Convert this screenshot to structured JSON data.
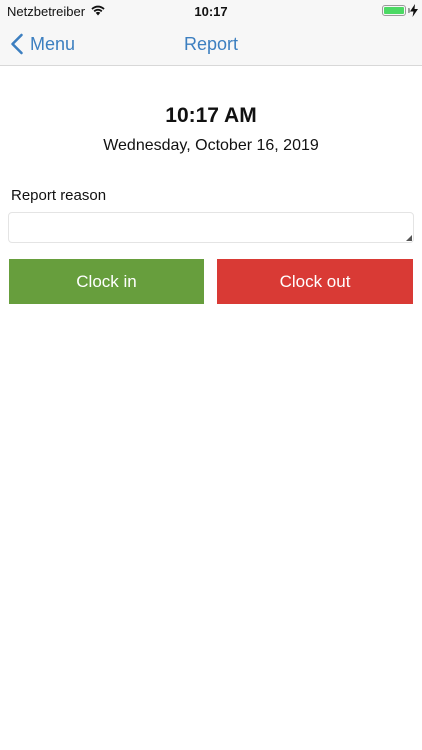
{
  "status_bar": {
    "carrier": "Netzbetreiber",
    "time": "10:17",
    "battery_level": 1.0,
    "icons": [
      "wifi-icon",
      "battery-icon",
      "charging-bolt-icon"
    ]
  },
  "nav": {
    "back_label": "Menu",
    "title": "Report",
    "back_icon": "chevron-left-icon"
  },
  "report": {
    "time": "10:17 AM",
    "date": "Wednesday, October 16, 2019",
    "reason_label": "Report reason",
    "reason_value": ""
  },
  "actions": {
    "clock_in_label": "Clock in",
    "clock_out_label": "Clock out"
  },
  "colors": {
    "accent": "#3c7fc0",
    "clock_in": "#679e3d",
    "clock_out": "#d93a35",
    "battery": "#4cd964"
  }
}
